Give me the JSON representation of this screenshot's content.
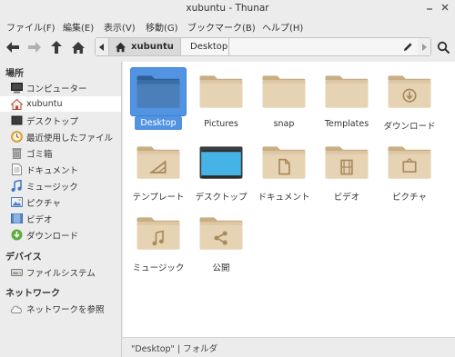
{
  "window": {
    "title": "xubuntu - Thunar"
  },
  "menu": [
    "ファイル(F)",
    "編集(E)",
    "表示(V)",
    "移動(G)",
    "ブックマーク(B)",
    "ヘルプ(H)"
  ],
  "pathbar": {
    "home_crumb": "xubuntu",
    "current_crumb": "Desktop"
  },
  "sidebar": {
    "places_heading": "場所",
    "places": [
      {
        "label": "コンピューター",
        "icon": "computer-icon"
      },
      {
        "label": "xubuntu",
        "icon": "home-icon",
        "active": true
      },
      {
        "label": "デスクトップ",
        "icon": "desktop-icon"
      },
      {
        "label": "最近使用したファイル",
        "icon": "recent-icon"
      },
      {
        "label": "ゴミ箱",
        "icon": "trash-icon"
      },
      {
        "label": "ドキュメント",
        "icon": "documents-icon"
      },
      {
        "label": "ミュージック",
        "icon": "music-icon"
      },
      {
        "label": "ピクチャ",
        "icon": "pictures-icon"
      },
      {
        "label": "ビデオ",
        "icon": "videos-icon"
      },
      {
        "label": "ダウンロード",
        "icon": "download-icon"
      }
    ],
    "devices_heading": "デバイス",
    "devices": [
      {
        "label": "ファイルシステム",
        "icon": "drive-icon"
      }
    ],
    "network_heading": "ネットワーク",
    "network": [
      {
        "label": "ネットワークを参照",
        "icon": "network-icon"
      }
    ]
  },
  "files": [
    {
      "name": "Desktop",
      "icon": "folder-desktop-icon",
      "selected": true
    },
    {
      "name": "Pictures",
      "icon": "folder-icon"
    },
    {
      "name": "snap",
      "icon": "folder-icon"
    },
    {
      "name": "Templates",
      "icon": "folder-icon"
    },
    {
      "name": "ダウンロード",
      "icon": "folder-download-icon"
    },
    {
      "name": "テンプレート",
      "icon": "folder-templates-icon"
    },
    {
      "name": "デスクトップ",
      "icon": "folder-desktop-alt-icon"
    },
    {
      "name": "ドキュメント",
      "icon": "folder-documents-icon"
    },
    {
      "name": "ビデオ",
      "icon": "folder-videos-icon"
    },
    {
      "name": "ピクチャ",
      "icon": "folder-pictures-icon"
    },
    {
      "name": "ミュージック",
      "icon": "folder-music-icon"
    },
    {
      "name": "公開",
      "icon": "folder-publicshare-icon"
    }
  ],
  "statusbar": {
    "text": "\"Desktop\"  |  フォルダ"
  },
  "colors": {
    "accent": "#5294e2",
    "folder": "#ddc7a4",
    "folder_dark": "#c9ad83",
    "folder_emblem": "#a88a5c"
  }
}
